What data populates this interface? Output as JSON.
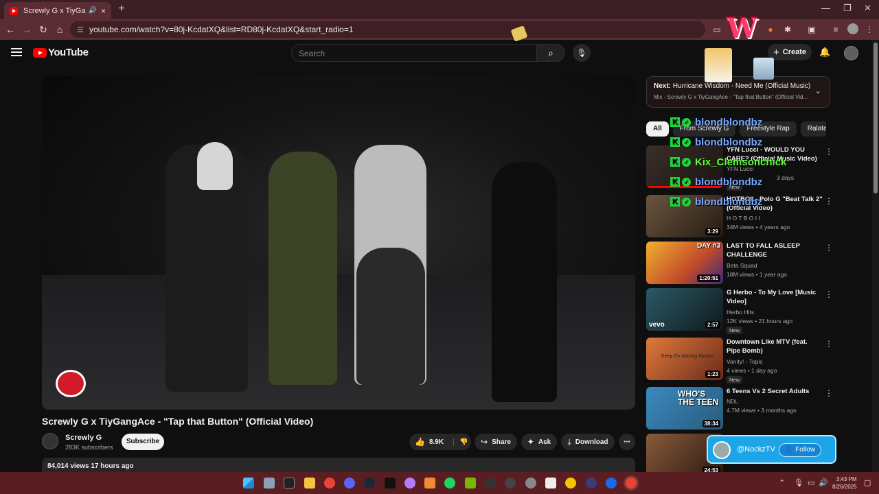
{
  "browser": {
    "tab_title": "Screwly G x TiyGangAce - \"",
    "tab_close": "×",
    "new_tab": "+",
    "url": "youtube.com/watch?v=80j-KcdatXQ&list=RD80j-KcdatXQ&start_radio=1"
  },
  "youtube": {
    "logo_text": "YouTube",
    "search_placeholder": "Search",
    "create_label": "Create"
  },
  "video": {
    "title": "Screwly G x TiyGangAce - \"Tap that Button\" (Official Video)",
    "channel": "Screwly G",
    "subscribers": "283K subscribers",
    "subscribe_label": "Subscribe",
    "likes": "8.9K",
    "share_label": "Share",
    "ask_label": "Ask",
    "download_label": "Download",
    "views_line": "84,014 views  17 hours ago"
  },
  "up_next": {
    "prefix": "Next:",
    "title": "Hurricane Wisdom - Need Me (Official Music)",
    "subtitle": "Mix - Screwly G x TiyGangAce - \"Tap that Button\" (Official Vid..."
  },
  "chips": [
    "All",
    "From Screwly G",
    "Freestyle Rap",
    "Relate"
  ],
  "recommendations": [
    {
      "title": "YFN Lucci - WOULD YOU CARE? (Official Music Video)",
      "channel": "YFN Lucci",
      "meta": "3 days",
      "badge": "New",
      "duration": "",
      "progress": 1.0,
      "color": "#3a2f2a"
    },
    {
      "title": "HOTBOII - Polo G \"Beat Talk 2\" (Official Video)",
      "channel": "H O T B O I I",
      "meta": "34M views • 4 years ago",
      "badge": "",
      "duration": "3:29",
      "progress": 0,
      "color": "#4b3b2c"
    },
    {
      "title": "LAST TO FALL ASLEEP CHALLENGE",
      "channel": "Beta Squad",
      "meta": "18M views • 1 year ago",
      "badge": "",
      "duration": "1:20:51",
      "progress": 0,
      "color": "#c24a2a"
    },
    {
      "title": "G Herbo - To My Love [Music Video]",
      "channel": "Herbo Hits",
      "meta": "12K views • 21 hours ago",
      "badge": "New",
      "duration": "2:57",
      "progress": 0,
      "color": "#1f3b44"
    },
    {
      "title": "Downtown Like MTV (feat. Pipe Bomb)",
      "channel": "Vanity! - Topic",
      "meta": "4 views • 1 day ago",
      "badge": "New",
      "duration": "1:23",
      "progress": 0,
      "color": "#8a3b23"
    },
    {
      "title": "6 Teens Vs 2 Secret Adults",
      "channel": "NDL",
      "meta": "4.7M views • 3 months ago",
      "badge": "",
      "duration": "38:34",
      "progress": 0,
      "color": "#2a6a8a"
    },
    {
      "title": "",
      "channel": "",
      "meta": "",
      "badge": "",
      "duration": "24:53",
      "progress": 0,
      "color": "#5a3a2a"
    }
  ],
  "overlay": {
    "chat": [
      {
        "name": "blondblondbz",
        "color": "#7aa7ff"
      },
      {
        "name": "blondblondbz",
        "color": "#7aa7ff"
      },
      {
        "name": "Kix_Clemsonchick",
        "color": "#5cff3a"
      },
      {
        "name": "blondblondbz",
        "color": "#7aa7ff"
      },
      {
        "name": "blondblondbz",
        "color": "#7aa7ff"
      }
    ],
    "follow_name": "@NockzTV",
    "follow_label": "Follow",
    "day_badge": "DAY #3",
    "thumb_text": "WHO'S THE TEEN",
    "thumb2_text": "Keep On Moving Always",
    "vevo": "vevo"
  },
  "taskbar": {
    "time": "3:43 PM",
    "date": "8/26/2025"
  }
}
